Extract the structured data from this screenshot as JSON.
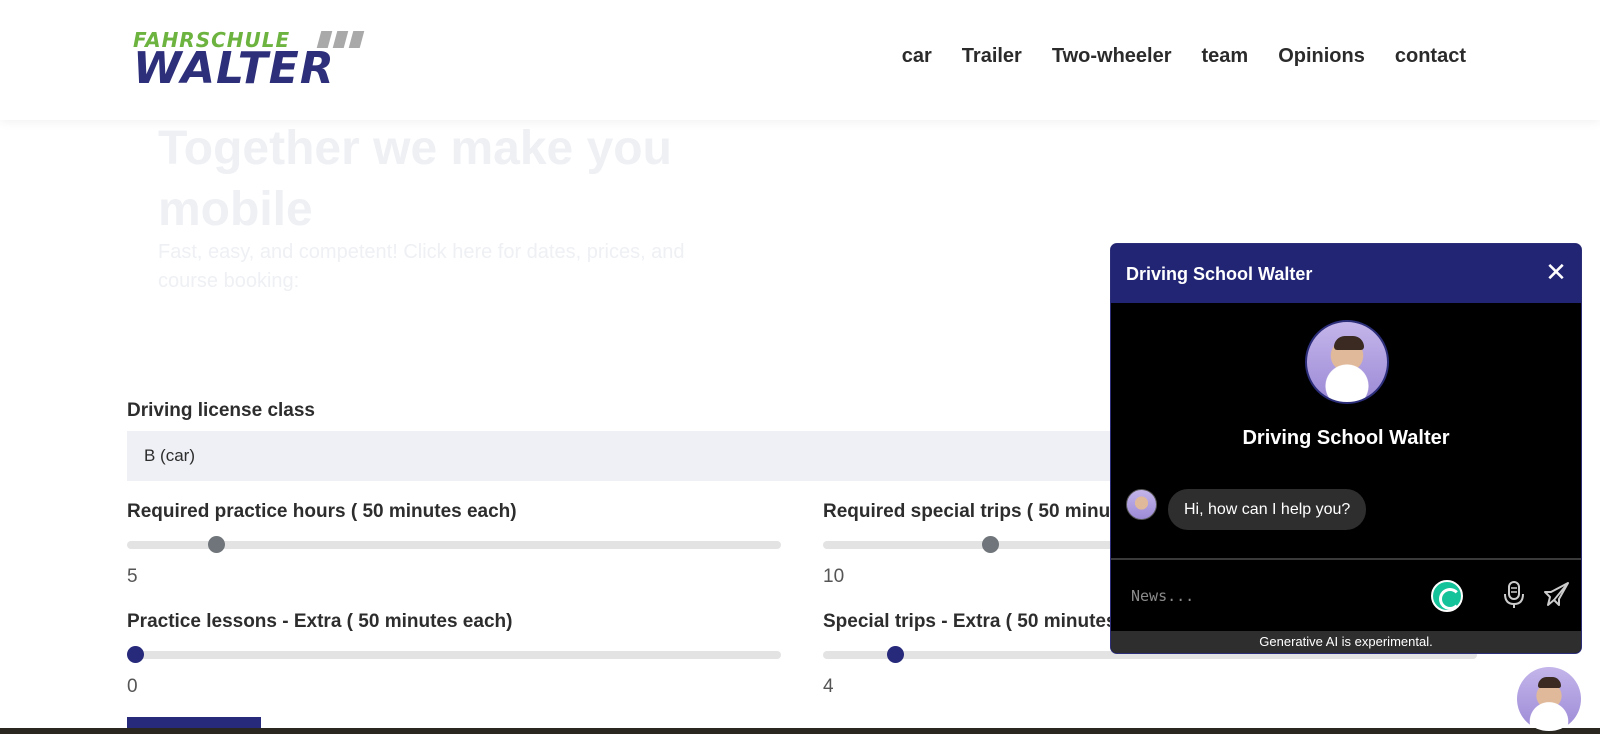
{
  "header": {
    "logo_top": "FAHRSCHULE",
    "logo_main": "WALTER",
    "nav": [
      "car",
      "Trailer",
      "Two-wheeler",
      "team",
      "Opinions",
      "contact"
    ]
  },
  "hero": {
    "title": "Together we make you mobile",
    "subtitle": "Fast, easy, and competent! Click here for dates, prices, and course booking:"
  },
  "form": {
    "license_label": "Driving license class",
    "license_value": "B (car)",
    "sliders": [
      {
        "label": "Required practice hours ( 50 minutes each)",
        "value": "5",
        "fraction": 0.136
      },
      {
        "label": "Required special trips ( 50 minutes each)",
        "value": "10",
        "fraction": 0.255
      },
      {
        "label": "Practice lessons - Extra ( 50 minutes each)",
        "value": "0",
        "fraction": 0.0
      },
      {
        "label": "Special trips - Extra ( 50 minutes each)",
        "value": "4",
        "fraction": 0.11
      }
    ]
  },
  "chat": {
    "title": "Driving School Walter",
    "close_symbol": "✕",
    "bot_name": "Driving School Walter",
    "greeting": "Hi, how can I help you?",
    "input_placeholder": "News...",
    "disclaimer": "Generative AI is experimental."
  },
  "colors": {
    "brand_navy": "#27297a",
    "brand_green": "#6cb33f",
    "chat_header": "#222474"
  }
}
